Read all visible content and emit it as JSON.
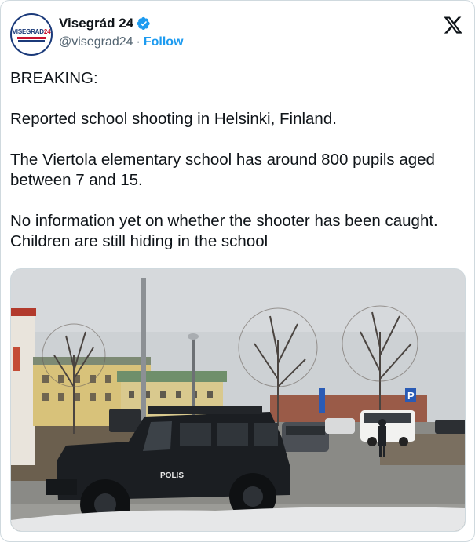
{
  "author": {
    "display_name": "Visegrád 24",
    "handle": "@visegrad24",
    "separator": "·",
    "follow_label": "Follow",
    "avatar_logo_text_a": "VISEGRAD",
    "avatar_logo_text_b": "24",
    "verified_color": "#1d9bf0"
  },
  "tweet": {
    "paragraphs": [
      "BREAKING:",
      "Reported school shooting in Helsinki, Finland.",
      "The Viertola elementary school has around 800 pupils aged between 7 and 15.",
      "No information yet on whether the shooter has been caught. Children are still hiding in the school"
    ]
  },
  "media": {
    "vehicle_label": "POLIS",
    "parking_sign": "P"
  },
  "icons": {
    "platform": "x-logo-icon",
    "verified": "verified-badge-icon"
  },
  "colors": {
    "accent": "#1d9bf0",
    "text": "#0f1419",
    "secondary": "#536471",
    "border": "#cfd9de"
  }
}
